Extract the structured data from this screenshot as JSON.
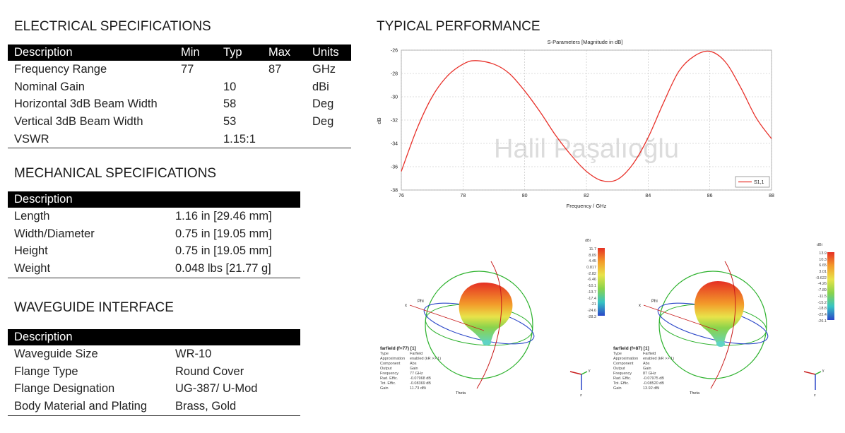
{
  "electrical": {
    "title": "ELECTRICAL SPECIFICATIONS",
    "headers": [
      "Description",
      "Min",
      "Typ",
      "Max",
      "Units"
    ],
    "rows": [
      [
        "Frequency Range",
        "77",
        "",
        "87",
        "GHz"
      ],
      [
        "Nominal Gain",
        "",
        "10",
        "",
        "dBi"
      ],
      [
        "Horizontal 3dB Beam Width",
        "",
        "58",
        "",
        "Deg"
      ],
      [
        "Vertical 3dB Beam Width",
        "",
        "53",
        "",
        "Deg"
      ],
      [
        "VSWR",
        "",
        "1.15:1",
        "",
        ""
      ]
    ]
  },
  "mechanical": {
    "title": "MECHANICAL SPECIFICATIONS",
    "header": "Description",
    "rows": [
      [
        "Length",
        "1.16 in [29.46 mm]"
      ],
      [
        "Width/Diameter",
        "0.75 in [19.05 mm]"
      ],
      [
        "Height",
        "0.75 in [19.05 mm]"
      ],
      [
        "Weight",
        "0.048 lbs [21.77 g]"
      ]
    ]
  },
  "waveguide": {
    "title": "WAVEGUIDE INTERFACE",
    "header": "Description",
    "rows": [
      [
        "Waveguide Size",
        "WR-10"
      ],
      [
        "Flange Type",
        "Round Cover"
      ],
      [
        "Flange Designation",
        "UG-387/ U-Mod"
      ],
      [
        "Body Material and Plating",
        "Brass, Gold"
      ]
    ]
  },
  "performance": {
    "title": "TYPICAL PERFORMANCE",
    "watermark": "Halil Paşalıoğlu"
  },
  "chart_data": {
    "type": "line",
    "title": "S-Parameters [Magnitude in dB]",
    "xlabel": "Frequency / GHz",
    "ylabel": "dB",
    "xlim": [
      76,
      88
    ],
    "ylim": [
      -38,
      -26
    ],
    "xticks": [
      76,
      78,
      80,
      82,
      84,
      86,
      88
    ],
    "yticks": [
      -26,
      -28,
      -30,
      -32,
      -34,
      -36,
      -38
    ],
    "grid": true,
    "legend_position": "bottom-right",
    "series": [
      {
        "name": "S1,1",
        "color": "#e8312a",
        "x": [
          76,
          76.5,
          77,
          77.5,
          78,
          78.4,
          79,
          79.5,
          80,
          80.5,
          81,
          81.5,
          82,
          82.5,
          83,
          83.5,
          84,
          84.5,
          85,
          85.5,
          86,
          86.5,
          87,
          87.5,
          88
        ],
        "y": [
          -36.4,
          -32.8,
          -30.0,
          -28.2,
          -27.2,
          -26.9,
          -27.2,
          -28.0,
          -29.5,
          -31.3,
          -33.3,
          -35.0,
          -36.4,
          -37.2,
          -37.1,
          -35.8,
          -33.5,
          -30.5,
          -27.8,
          -26.5,
          -26.1,
          -27.0,
          -29.2,
          -31.8,
          -33.6
        ]
      }
    ]
  },
  "farfield_left": {
    "colorbar_unit": "dBi",
    "colorbar_ticks": [
      "11.7",
      "8.09",
      "4.45",
      "0.817",
      "-2.82",
      "-6.46",
      "-10.1",
      "-13.7",
      "-17.4",
      "-21",
      "-24.6",
      "-28.3"
    ],
    "panel_title": "farfield (f=77) [1]",
    "props": [
      [
        "Type",
        "Farfield"
      ],
      [
        "Approximation",
        "enabled (kR >> 1)"
      ],
      [
        "Component",
        "Abs"
      ],
      [
        "Output",
        "Gain"
      ],
      [
        "Frequency",
        "77 GHz"
      ],
      [
        "Rad. Effic.",
        "-0.07968 dB"
      ],
      [
        "Tot. Effic.",
        "-0.08369 dB"
      ],
      [
        "Gain",
        "11.73 dBi"
      ]
    ],
    "axis_labels": [
      "Phi",
      "x",
      "Theta",
      "y",
      "z"
    ]
  },
  "farfield_right": {
    "colorbar_unit": "dBi",
    "colorbar_ticks": [
      "13.9",
      "10.3",
      "6.65",
      "3.01",
      "-0.622",
      "-4.26",
      "-7.89",
      "-11.5",
      "-15.2",
      "-18.8",
      "-22.4",
      "-26.1"
    ],
    "panel_title": "farfield (f=87) [1]",
    "props": [
      [
        "Type",
        "Farfield"
      ],
      [
        "Approximation",
        "enabled (kR >> 1)"
      ],
      [
        "Component",
        "Abs"
      ],
      [
        "Output",
        "Gain"
      ],
      [
        "Frequency",
        "87 GHz"
      ],
      [
        "Rad. Effic.",
        "-0.07975 dB"
      ],
      [
        "Tot. Effic.",
        "-0.08520 dB"
      ],
      [
        "Gain",
        "13.92 dBi"
      ]
    ],
    "axis_labels": [
      "Phi",
      "x",
      "Theta",
      "y",
      "z"
    ]
  }
}
